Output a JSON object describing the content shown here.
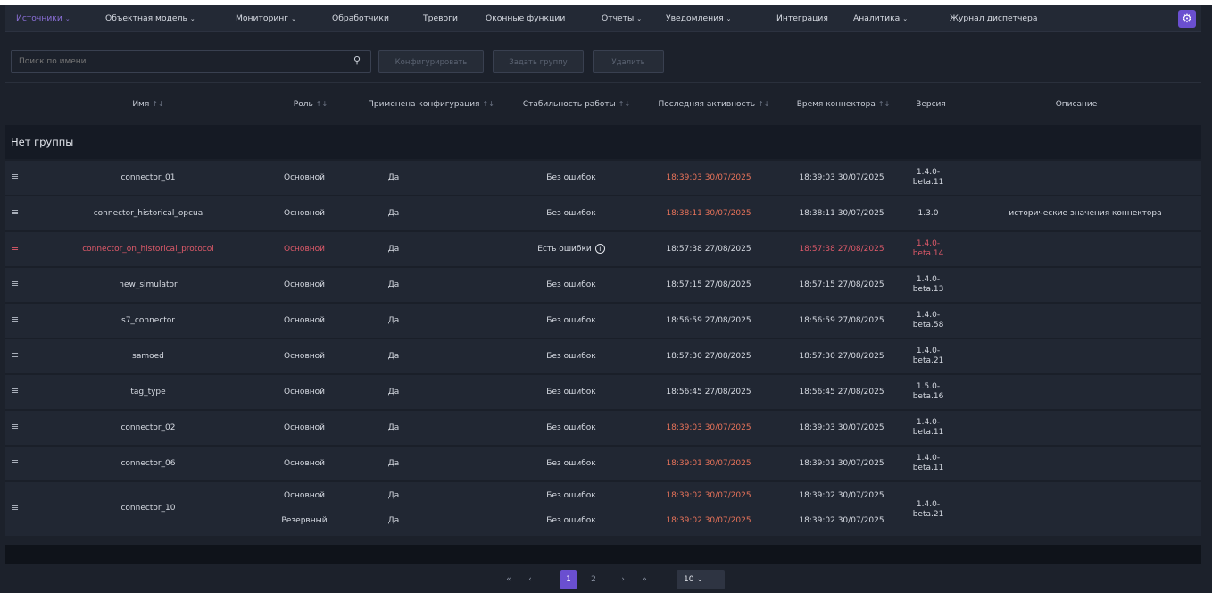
{
  "nav": {
    "items": [
      {
        "label": "Источники",
        "caret": "⌄"
      },
      {
        "label": "Объектная модель",
        "caret": "⌄"
      },
      {
        "label": "Мониторинг",
        "caret": "⌄"
      },
      {
        "label": "Обработчики",
        "caret": ""
      },
      {
        "label": "Тревоги",
        "caret": ""
      },
      {
        "label": "Оконные функции",
        "caret": ""
      },
      {
        "label": "Отчеты",
        "caret": "⌄"
      },
      {
        "label": "Уведомления",
        "caret": "⌄"
      },
      {
        "label": "Интеграция",
        "caret": ""
      },
      {
        "label": "Аналитика",
        "caret": "⌄"
      },
      {
        "label": "Журнал диспетчера",
        "caret": ""
      }
    ],
    "settings_icon": "gear-icon"
  },
  "toolbar": {
    "search_placeholder": "Поиск по имени",
    "configure_label": "Конфигурировать",
    "set_group_label": "Задать группу",
    "delete_label": "Удалить"
  },
  "table": {
    "headers": {
      "name": "Имя",
      "role": "Роль",
      "config": "Применена конфигурация",
      "stability": "Стабильность работы",
      "activity": "Последняя активность",
      "connector_time": "Время коннектора",
      "version": "Версия",
      "description": "Описание",
      "sort_icon": "↑↓"
    },
    "group_label": "Нет группы",
    "rows": [
      {
        "name": "connector_01",
        "role": "Основной",
        "config": "Да",
        "stability": "Без ошибок",
        "activity": "18:39:03 30/07/2025",
        "connector_time": "18:39:03 30/07/2025",
        "version_1": "1.4.0-",
        "version_2": "beta.11",
        "description": ""
      },
      {
        "name": "connector_historical_opcua",
        "role": "Основной",
        "config": "Да",
        "stability": "Без ошибок",
        "activity": "18:38:11 30/07/2025",
        "connector_time": "18:38:11 30/07/2025",
        "version_1": "1.3.0",
        "version_2": "",
        "description": "исторические значения коннектора"
      },
      {
        "name": "connector_on_historical_protocol",
        "role": "Основной",
        "config": "Да",
        "stability": "Есть ошибки",
        "activity": "18:57:38 27/08/2025",
        "connector_time": "18:57:38 27/08/2025",
        "version_1": "1.4.0-",
        "version_2": "beta.14",
        "description": ""
      },
      {
        "name": "new_simulator",
        "role": "Основной",
        "config": "Да",
        "stability": "Без ошибок",
        "activity": "18:57:15 27/08/2025",
        "connector_time": "18:57:15 27/08/2025",
        "version_1": "1.4.0-",
        "version_2": "beta.13",
        "description": ""
      },
      {
        "name": "s7_connector",
        "role": "Основной",
        "config": "Да",
        "stability": "Без ошибок",
        "activity": "18:56:59 27/08/2025",
        "connector_time": "18:56:59 27/08/2025",
        "version_1": "1.4.0-",
        "version_2": "beta.58",
        "description": ""
      },
      {
        "name": "samoed",
        "role": "Основной",
        "config": "Да",
        "stability": "Без ошибок",
        "activity": "18:57:30 27/08/2025",
        "connector_time": "18:57:30 27/08/2025",
        "version_1": "1.4.0-",
        "version_2": "beta.21",
        "description": ""
      },
      {
        "name": "tag_type",
        "role": "Основной",
        "config": "Да",
        "stability": "Без ошибок",
        "activity": "18:56:45 27/08/2025",
        "connector_time": "18:56:45 27/08/2025",
        "version_1": "1.5.0-",
        "version_2": "beta.16",
        "description": ""
      },
      {
        "name": "connector_02",
        "role": "Основной",
        "config": "Да",
        "stability": "Без ошибок",
        "activity": "18:39:03 30/07/2025",
        "connector_time": "18:39:03 30/07/2025",
        "version_1": "1.4.0-",
        "version_2": "beta.11",
        "description": ""
      },
      {
        "name": "connector_06",
        "role": "Основной",
        "config": "Да",
        "stability": "Без ошибок",
        "activity": "18:39:01 30/07/2025",
        "connector_time": "18:39:01 30/07/2025",
        "version_1": "1.4.0-",
        "version_2": "beta.11",
        "description": ""
      },
      {
        "name": "connector_10",
        "version_1": "1.4.0-",
        "version_2": "beta.21",
        "description": "",
        "sub": [
          {
            "role": "Основной",
            "config": "Да",
            "stability": "Без ошибок",
            "activity": "18:39:02 30/07/2025",
            "connector_time": "18:39:02 30/07/2025"
          },
          {
            "role": "Резервный",
            "config": "Да",
            "stability": "Без ошибок",
            "activity": "18:39:02 30/07/2025",
            "connector_time": "18:39:02 30/07/2025"
          }
        ]
      }
    ]
  },
  "pagination": {
    "first": "«",
    "prev": "‹",
    "page_1": "1",
    "page_2": "2",
    "next": "›",
    "last": "»",
    "page_size": "10",
    "page_size_caret": "⌄"
  },
  "colors": {
    "accent": "#6a4fd0",
    "active_nav": "#8b6fd8",
    "error": "#e05a6a",
    "stale_timestamp": "#e8735a"
  }
}
